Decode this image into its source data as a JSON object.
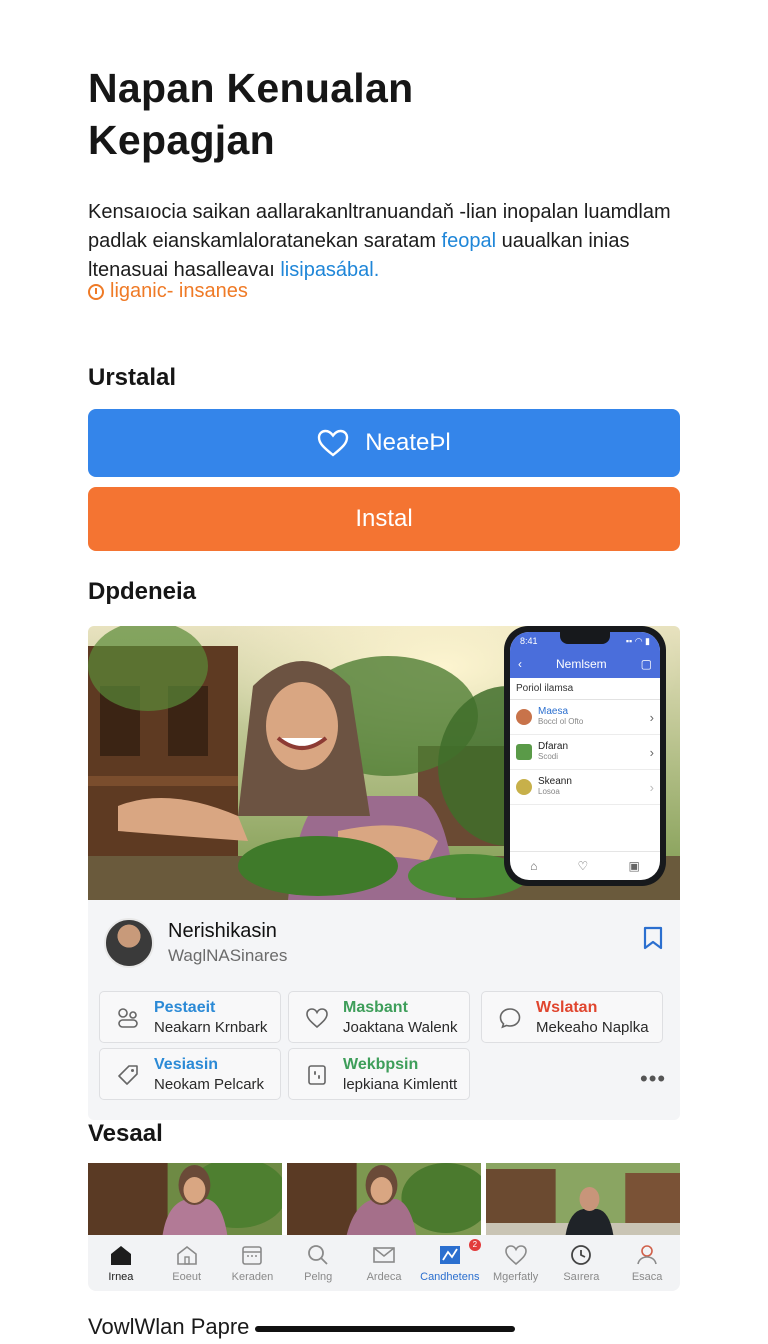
{
  "header": {
    "title_line1": "Napan Kenualan",
    "title_line2": "Kepagjan"
  },
  "description": {
    "line1": "Kensaıocia saikan aallarakanltranuandaň ‑lian inopalan luamdlam",
    "line2_a": "padlak eianskamlaloratanekan saratam ",
    "line2_link": "feopal",
    "line2_b": " uaualkan inias",
    "line3_a": "ltenasuai hasalleavaı ",
    "line3_link": "lisipasábal."
  },
  "installs": {
    "label": "liganic- insanes"
  },
  "install_section": {
    "heading": "Urstalal",
    "primary_label": "NeateÞl",
    "secondary_label": "Instal"
  },
  "preview_section": {
    "heading": "Dpdeneia",
    "phone": {
      "time": "8:41",
      "header": "Nemlsem",
      "subheader": "Poriol ilamsa",
      "items": [
        {
          "name": "Maesa",
          "sub": "Boccl ol Ofto"
        },
        {
          "name": "Dfaran",
          "sub": "Scodi"
        },
        {
          "name": "Skeann",
          "sub": "Losoa"
        }
      ]
    },
    "profile": {
      "name": "Nerishikasin",
      "subtitle": "WaglNASinares"
    },
    "chips": [
      {
        "title": "Pestaeit",
        "subtitle": "Neakarn Krnbark",
        "color": "#2b8ad6"
      },
      {
        "title": "Masbant",
        "subtitle": "Joaktana Walenk",
        "color": "#3e9e5a"
      },
      {
        "title": "Wslatan",
        "subtitle": "Mekeaho Naplka",
        "color": "#e0452e"
      },
      {
        "title": "Vesiasin",
        "subtitle": "Neokam Pelcark",
        "color": "#2b8ad6"
      },
      {
        "title": "Wekbpsin",
        "subtitle": "lepkiana Kimlentt",
        "color": "#3e9e5a"
      }
    ],
    "more_label": "•••"
  },
  "gallery_section": {
    "heading": "Vesaal"
  },
  "tabbar": {
    "tabs": [
      {
        "label": "Irnea"
      },
      {
        "label": "Eoeut"
      },
      {
        "label": "Keraden"
      },
      {
        "label": "Pelng"
      },
      {
        "label": "Ardeca"
      },
      {
        "label": "Candhetens",
        "badge": "2"
      },
      {
        "label": "Mgerfatly"
      },
      {
        "label": "Saırera"
      },
      {
        "label": "Esaca"
      }
    ]
  },
  "footer": {
    "text": "VowlWlan Papre"
  },
  "colors": {
    "primary_blue": "#3485ea",
    "accent_orange": "#f47432",
    "link_blue": "#1f86d8"
  }
}
